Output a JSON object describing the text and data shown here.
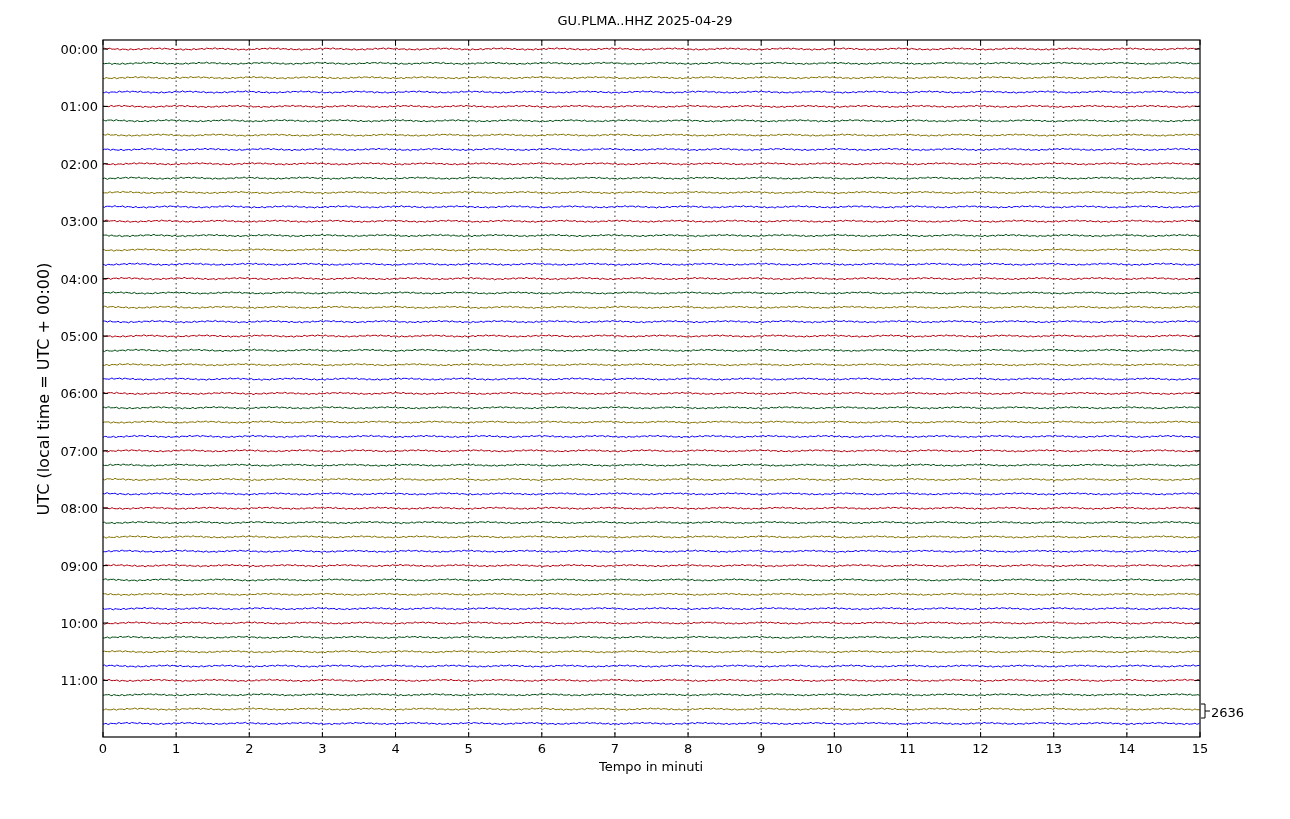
{
  "title": "GU.PLMA..HHZ 2025-04-29",
  "ylabel": "UTC (local time = UTC + 00:00)",
  "xlabel": "Tempo in minuti",
  "xticks": [
    "0",
    "1",
    "2",
    "3",
    "4",
    "5",
    "6",
    "7",
    "8",
    "9",
    "10",
    "11",
    "12",
    "13",
    "14",
    "15"
  ],
  "yticks": [
    "00:00",
    "01:00",
    "02:00",
    "03:00",
    "04:00",
    "05:00",
    "06:00",
    "07:00",
    "08:00",
    "09:00",
    "10:00",
    "11:00"
  ],
  "scale_label": "2636",
  "traces": [
    {
      "color": "#b2000f"
    },
    {
      "color": "#004c12"
    },
    {
      "color": "#847200"
    },
    {
      "color": "#0e01ff"
    },
    {
      "color": "#b2000f"
    },
    {
      "color": "#004c12"
    },
    {
      "color": "#847200"
    },
    {
      "color": "#0e01ff"
    },
    {
      "color": "#b2000f"
    },
    {
      "color": "#004c12"
    },
    {
      "color": "#847200"
    },
    {
      "color": "#0e01ff"
    },
    {
      "color": "#b2000f"
    },
    {
      "color": "#004c12"
    },
    {
      "color": "#847200"
    },
    {
      "color": "#0e01ff"
    },
    {
      "color": "#b2000f"
    },
    {
      "color": "#004c12"
    },
    {
      "color": "#847200"
    },
    {
      "color": "#0e01ff"
    },
    {
      "color": "#b2000f"
    },
    {
      "color": "#004c12"
    },
    {
      "color": "#847200"
    },
    {
      "color": "#0e01ff"
    },
    {
      "color": "#b2000f"
    },
    {
      "color": "#004c12"
    },
    {
      "color": "#847200"
    },
    {
      "color": "#0e01ff"
    },
    {
      "color": "#b2000f"
    },
    {
      "color": "#004c12"
    },
    {
      "color": "#847200"
    },
    {
      "color": "#0e01ff"
    },
    {
      "color": "#b2000f"
    },
    {
      "color": "#004c12"
    },
    {
      "color": "#847200"
    },
    {
      "color": "#0e01ff"
    },
    {
      "color": "#b2000f"
    },
    {
      "color": "#004c12"
    },
    {
      "color": "#847200"
    },
    {
      "color": "#0e01ff"
    },
    {
      "color": "#b2000f"
    },
    {
      "color": "#004c12"
    },
    {
      "color": "#847200"
    },
    {
      "color": "#0e01ff"
    },
    {
      "color": "#b2000f"
    },
    {
      "color": "#004c12"
    },
    {
      "color": "#847200"
    },
    {
      "color": "#0e01ff"
    }
  ]
}
